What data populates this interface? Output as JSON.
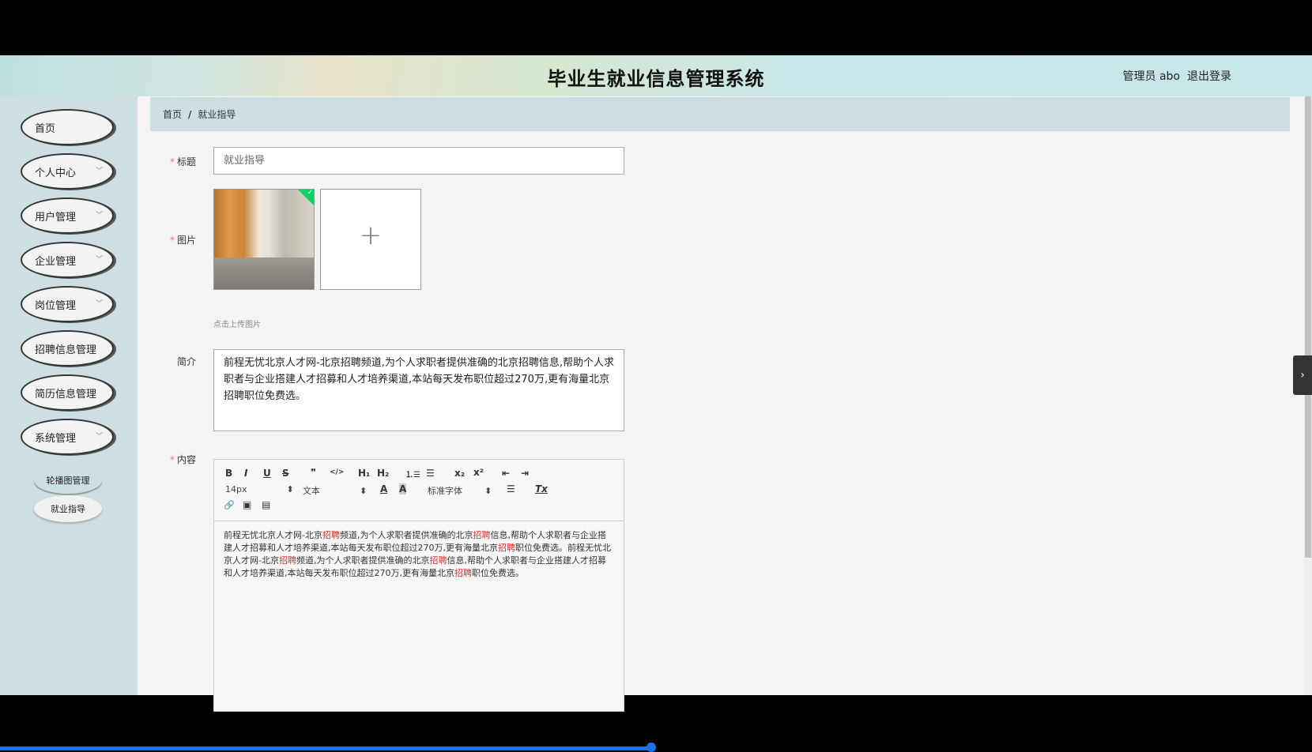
{
  "header": {
    "title": "毕业生就业信息管理系统",
    "user": "管理员 abo",
    "logout": "退出登录"
  },
  "sidebar": {
    "items": [
      {
        "label": "首页",
        "has_children": false
      },
      {
        "label": "个人中心",
        "has_children": true
      },
      {
        "label": "用户管理",
        "has_children": true
      },
      {
        "label": "企业管理",
        "has_children": true
      },
      {
        "label": "岗位管理",
        "has_children": true
      },
      {
        "label": "招聘信息管理",
        "has_children": false
      },
      {
        "label": "简历信息管理",
        "has_children": false
      },
      {
        "label": "系统管理",
        "has_children": true
      }
    ],
    "subitems": [
      {
        "label": "轮播图管理"
      },
      {
        "label": "就业指导"
      }
    ]
  },
  "breadcrumb": {
    "home": "首页",
    "sep": "/",
    "current": "就业指导"
  },
  "form": {
    "title_label": "标题",
    "title_value": "就业指导",
    "image_label": "图片",
    "upload_hint": "点击上传图片",
    "intro_label": "简介",
    "intro_value": "前程无忧北京人才网-北京招聘频道,为个人求职者提供准确的北京招聘信息,帮助个人求职者与企业搭建人才招募和人才培养渠道,本站每天发布职位超过270万,更有海量北京招聘职位免费选。",
    "content_label": "内容"
  },
  "editor": {
    "toolbar": {
      "bold": "B",
      "italic": "I",
      "underline": "U",
      "strike": "S",
      "quote": "❞",
      "code": "</>",
      "h1": "H₁",
      "h2": "H₂",
      "ol": "⒈☰",
      "ul": "☰",
      "sub": "x₂",
      "sup": "x²",
      "outdent": "⇤",
      "indent": "⇥",
      "size": "14px",
      "header": "文本",
      "color": "A",
      "background": "A",
      "font": "标准字体",
      "align": "☰",
      "clean": "Tx",
      "link": "🔗",
      "image": "▣",
      "video": "▤"
    },
    "segments": [
      {
        "t": "前程无忧北京人才网-北京",
        "hl": false
      },
      {
        "t": "招聘",
        "hl": true
      },
      {
        "t": "频道,为个人求职者提供准确的北京",
        "hl": false
      },
      {
        "t": "招聘",
        "hl": true
      },
      {
        "t": "信息,帮助个人求职者与企业搭建人才招募和人才培养渠道,本站每天发布职位超过270万,更有海量北京",
        "hl": false
      },
      {
        "t": "招聘",
        "hl": true
      },
      {
        "t": "职位免费选。前程无忧北京人才网-北京",
        "hl": false
      },
      {
        "t": "招聘",
        "hl": true
      },
      {
        "t": "频道,为个人求职者提供准确的北京",
        "hl": false
      },
      {
        "t": "招聘",
        "hl": true
      },
      {
        "t": "信息,帮助个人求职者与企业搭建人才招募和人才培养渠道,本站每天发布职位超过270万,更有海量北京",
        "hl": false
      },
      {
        "t": "招聘",
        "hl": true
      },
      {
        "t": "职位免费选。",
        "hl": false
      }
    ],
    "highlight_color": "#e03030"
  },
  "side_tab": {
    "icon": "›"
  }
}
